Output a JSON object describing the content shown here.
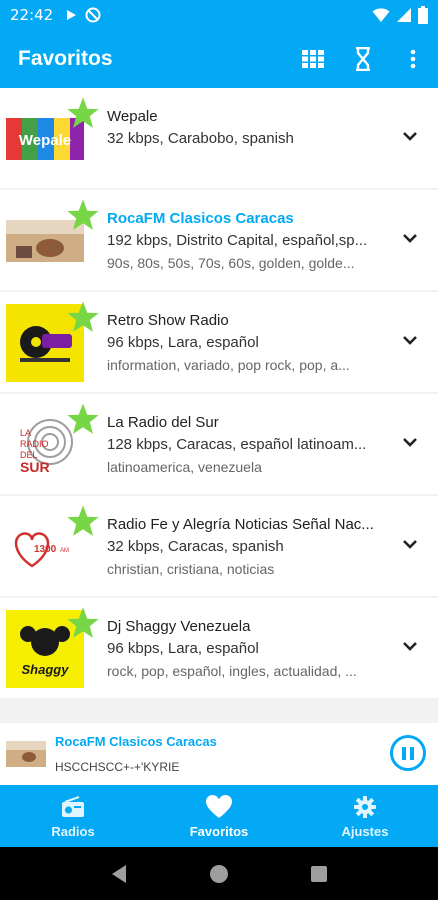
{
  "status_bar": {
    "time": "22:42",
    "left_icons": [
      "play-icon",
      "no-disturb-icon"
    ],
    "right_icons": [
      "wifi-icon",
      "signal-icon",
      "battery-icon"
    ]
  },
  "app_bar": {
    "title": "Favoritos",
    "actions": [
      "grid-view-icon",
      "hourglass-icon",
      "more-vert-icon"
    ]
  },
  "stations": [
    {
      "name": "Wepale",
      "info": "32 kbps, Carabobo, spanish",
      "tags": "",
      "logo_text": "Wepale",
      "active": false
    },
    {
      "name": "RocaFM Clasicos Caracas",
      "info": "192 kbps, Distrito Capital, español,sp...",
      "tags": "90s, 80s, 50s, 70s, 60s, golden, golde...",
      "logo_text": "",
      "active": true
    },
    {
      "name": "Retro Show Radio",
      "info": "96 kbps, Lara, español",
      "tags": "information, variado, pop rock, pop, a...",
      "logo_text": "",
      "active": false
    },
    {
      "name": "La Radio del Sur",
      "info": "128 kbps, Caracas, español latinoam...",
      "tags": "latinoamerica, venezuela",
      "logo_text": "LA RADIO DEL SUR",
      "active": false
    },
    {
      "name": "Radio Fe y Alegría Noticias Señal Nac...",
      "info": "32 kbps, Caracas, spanish",
      "tags": "christian, cristiana, noticias",
      "logo_text": "1300 AM",
      "active": false
    },
    {
      "name": "Dj Shaggy Venezuela",
      "info": "96 kbps, Lara, español",
      "tags": "rock, pop, español, ingles, actualidad, ...",
      "logo_text": "Shaggy",
      "active": false
    }
  ],
  "player": {
    "title": "RocaFM Clasicos Caracas",
    "subtitle": "HSCCHSCC+-+'KYRIE",
    "state": "playing"
  },
  "bottom_nav": [
    {
      "label": "Radios",
      "icon": "radio-icon",
      "active": false
    },
    {
      "label": "Favoritos",
      "icon": "heart-icon",
      "active": true
    },
    {
      "label": "Ajustes",
      "icon": "gear-icon",
      "active": false
    }
  ],
  "colors": {
    "primary": "#03a9f4",
    "star": "#76d645"
  }
}
